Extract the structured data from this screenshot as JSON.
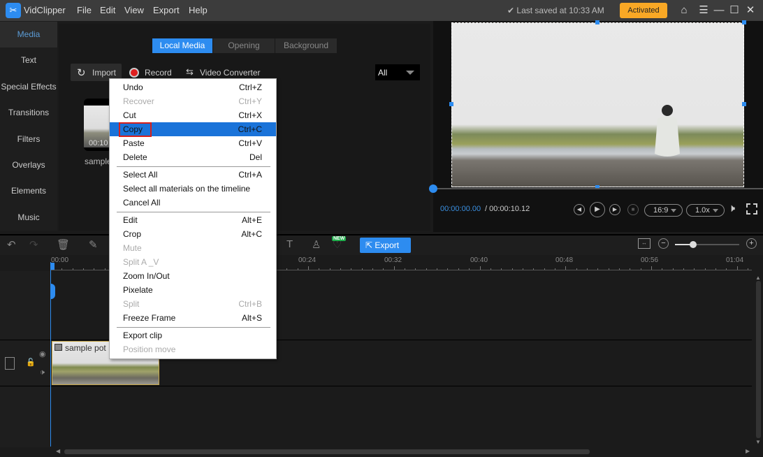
{
  "app": {
    "name": "VidClipper",
    "menu": [
      "File",
      "Edit",
      "View",
      "Export",
      "Help"
    ],
    "saved_status": "✔ Last saved at 10:33 AM",
    "activated_label": "Activated"
  },
  "window_controls": {
    "home": "⌂",
    "menu": "☰",
    "minimize": "—",
    "maximize": "☐",
    "close": "✕"
  },
  "sidebar": {
    "items": [
      {
        "label": "Media",
        "active": true
      },
      {
        "label": "Text"
      },
      {
        "label": "Special Effects"
      },
      {
        "label": "Transitions"
      },
      {
        "label": "Filters"
      },
      {
        "label": "Overlays"
      },
      {
        "label": "Elements"
      },
      {
        "label": "Music"
      }
    ]
  },
  "media": {
    "tabs": [
      {
        "label": "Local Media",
        "active": true
      },
      {
        "label": "Opening"
      },
      {
        "label": "Background"
      }
    ],
    "toolbar": {
      "import": "Import",
      "record": "Record",
      "converter": "Video Converter"
    },
    "filter": {
      "selected": "All"
    },
    "items": [
      {
        "name": "sample",
        "duration": "00:10"
      }
    ]
  },
  "preview": {
    "current_time": "00:00:00.00",
    "total_time": "/ 00:00:10.12",
    "aspect": "16:9",
    "speed": "1.0x",
    "progress": 0
  },
  "timeline": {
    "export_label": "Export",
    "new_badge": "NEW",
    "ruler_labels": [
      "00:00",
      "00:24",
      "00:32",
      "00:40",
      "00:48",
      "00:56",
      "01:04"
    ],
    "zoom_level": 0.28,
    "clip": {
      "name": "sample pot"
    }
  },
  "context_menu": {
    "groups": [
      [
        {
          "label": "Undo",
          "shortcut": "Ctrl+Z",
          "disabled": false
        },
        {
          "label": "Recover",
          "shortcut": "Ctrl+Y",
          "disabled": true
        },
        {
          "label": "Cut",
          "shortcut": "Ctrl+X",
          "disabled": false
        },
        {
          "label": "Copy",
          "shortcut": "Ctrl+C",
          "disabled": false,
          "highlighted": true
        },
        {
          "label": "Paste",
          "shortcut": "Ctrl+V",
          "disabled": false
        },
        {
          "label": "Delete",
          "shortcut": "Del",
          "disabled": false
        }
      ],
      [
        {
          "label": "Select All",
          "shortcut": "Ctrl+A",
          "disabled": false
        },
        {
          "label": "Select all materials on the timeline",
          "shortcut": "",
          "disabled": false
        },
        {
          "label": "Cancel All",
          "shortcut": "",
          "disabled": false
        }
      ],
      [
        {
          "label": "Edit",
          "shortcut": "Alt+E",
          "disabled": false
        },
        {
          "label": "Crop",
          "shortcut": "Alt+C",
          "disabled": false
        },
        {
          "label": "Mute",
          "shortcut": "",
          "disabled": true
        },
        {
          "label": "Split A _V",
          "shortcut": "",
          "disabled": true
        },
        {
          "label": "Zoom In/Out",
          "shortcut": "",
          "disabled": false
        },
        {
          "label": "Pixelate",
          "shortcut": "",
          "disabled": false
        },
        {
          "label": "Split",
          "shortcut": "Ctrl+B",
          "disabled": true
        },
        {
          "label": "Freeze Frame",
          "shortcut": "Alt+S",
          "disabled": false
        }
      ],
      [
        {
          "label": "Export clip",
          "shortcut": "",
          "disabled": false
        },
        {
          "label": "Position move",
          "shortcut": "",
          "disabled": true
        }
      ]
    ]
  }
}
